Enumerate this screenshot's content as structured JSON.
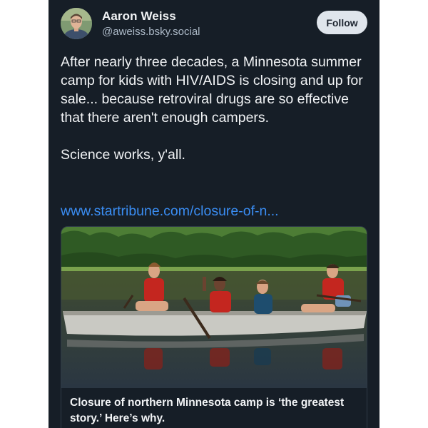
{
  "author": {
    "name": "Aaron Weiss",
    "handle": "@aweiss.bsky.social"
  },
  "actions": {
    "follow_label": "Follow"
  },
  "post": {
    "paragraphs": [
      "After nearly three decades, a Minnesota summer camp for kids with HIV/AIDS is closing and up for sale... because retroviral drugs are so effective that there aren't enough campers.",
      "Science works, y'all."
    ],
    "link_text": "www.startribune.com/closure-of-n..."
  },
  "embed": {
    "title": "Closure of northern Minnesota camp is ‘the greatest story.’ Here’s why."
  },
  "colors": {
    "background": "#161e27",
    "text": "#f1f3f5",
    "handle": "#aebbc9",
    "link": "#3a8df3",
    "follow_button": "#dfe5ec"
  },
  "icons": [
    "avatar-photo",
    "embed-photo"
  ]
}
